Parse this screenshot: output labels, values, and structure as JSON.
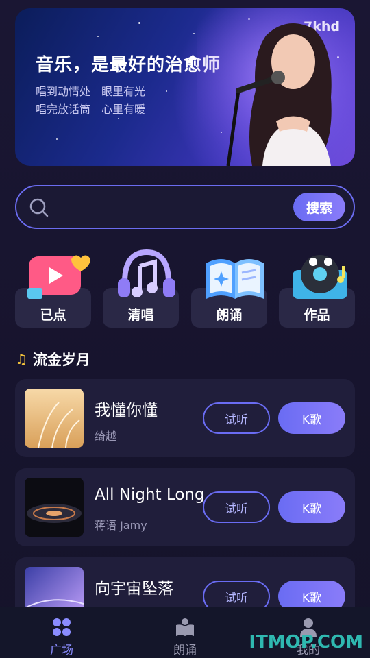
{
  "banner": {
    "brand": "7khd",
    "title": "音乐，是最好的治愈师",
    "subtitle_line1": "唱到动情处　眼里有光",
    "subtitle_line2": "唱完放话筒　心里有暖"
  },
  "search": {
    "placeholder": "",
    "button_label": "搜索"
  },
  "categories": [
    {
      "label": "已点",
      "icon": "heart-video-icon"
    },
    {
      "label": "清唱",
      "icon": "headphones-music-icon"
    },
    {
      "label": "朗诵",
      "icon": "open-book-icon"
    },
    {
      "label": "作品",
      "icon": "record-player-icon"
    }
  ],
  "section": {
    "title": "流金岁月"
  },
  "songs": [
    {
      "title": "我懂你懂",
      "artist": "绮越",
      "listen_label": "试听",
      "k_label": "K歌"
    },
    {
      "title": "All Night Long",
      "artist": "蒋语 Jamy",
      "listen_label": "试听",
      "k_label": "K歌"
    },
    {
      "title": "向宇宙坠落",
      "artist": "",
      "listen_label": "试听",
      "k_label": "K歌"
    }
  ],
  "tabs": [
    {
      "label": "广场",
      "icon": "grid-icon",
      "active": true
    },
    {
      "label": "朗诵",
      "icon": "book-reader-icon",
      "active": false
    },
    {
      "label": "我的",
      "icon": "user-icon",
      "active": false
    }
  ],
  "watermark": "ITMOP.COM",
  "colors": {
    "accent": "#6a6cf3",
    "background": "#17142c",
    "card": "#201e3b"
  }
}
